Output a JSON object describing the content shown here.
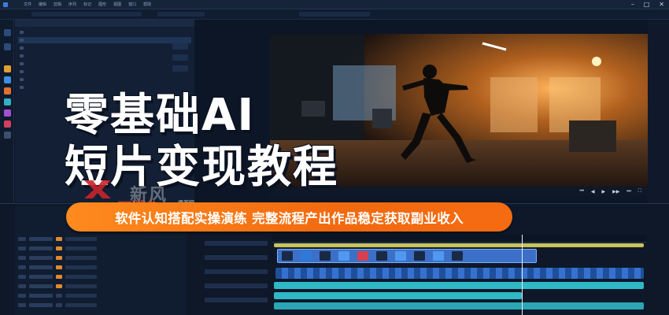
{
  "app": {
    "menu": [
      "文件",
      "编辑",
      "剪辑",
      "序列",
      "标记",
      "图形",
      "视图",
      "窗口",
      "帮助"
    ]
  },
  "headline": {
    "line1": "零基础AI",
    "line2": "短片变现教程"
  },
  "banner": {
    "text": "软件认知搭配实操演练 完整流程产出作品稳定获取副业收入"
  },
  "watermark": {
    "url": "www.xinfx.vip",
    "cn": "资源网",
    "name": "新风"
  },
  "player": {
    "controls": [
      "⏮",
      "◀",
      "▶",
      "▶▶",
      "⏭",
      "⛶"
    ]
  },
  "colors": {
    "bg": "#0d1626",
    "accent_orange": "#f57a17",
    "track_cyan": "#2fb8c6",
    "track_blue": "#2d6fd8",
    "track_yellow": "#c9c35a"
  },
  "icons": [
    "home-icon",
    "folder-icon",
    "effects-icon",
    "audio-icon",
    "text-icon",
    "settings-icon"
  ]
}
